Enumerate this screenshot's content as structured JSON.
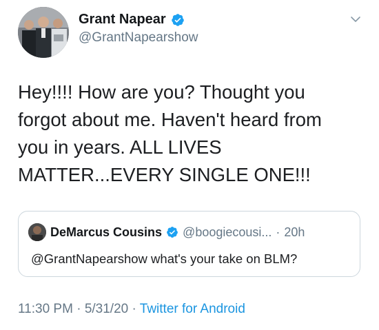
{
  "author": {
    "display_name": "Grant Napear",
    "handle": "@GrantNapearshow",
    "avatar_icon": "avatar-photo",
    "verified_icon": "verified-badge-icon"
  },
  "tweet": {
    "text": "Hey!!!! How are you? Thought you\nforgot about me.  Haven't heard from\nyou in years. ALL LIVES\nMATTER...EVERY SINGLE ONE!!!"
  },
  "quoted_tweet": {
    "display_name": "DeMarcus Cousins",
    "handle": "@boogiecousi...",
    "separator": "·",
    "time": "20h",
    "text": "@GrantNapearshow what's your take on BLM?"
  },
  "meta": {
    "time": "11:30 PM",
    "separator1": "·",
    "date": "5/31/20",
    "separator2": "·",
    "source": "Twitter for Android"
  },
  "colors": {
    "verified": "#1da1f2",
    "secondary_text": "#657786",
    "link": "#1b95e0",
    "border": "#ccd6dd"
  }
}
